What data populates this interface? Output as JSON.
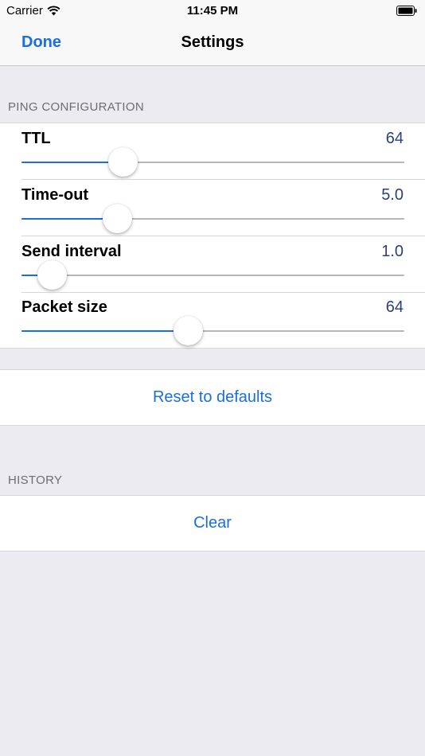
{
  "status_bar": {
    "carrier": "Carrier",
    "time": "11:45 PM",
    "wifi_icon": "wifi-icon",
    "battery_icon": "battery-icon"
  },
  "nav": {
    "done_label": "Done",
    "title": "Settings"
  },
  "ping_configuration": {
    "header": "PING CONFIGURATION",
    "sliders": [
      {
        "label": "TTL",
        "value": "64",
        "fraction": 0.265
      },
      {
        "label": "Time-out",
        "value": "5.0",
        "fraction": 0.25
      },
      {
        "label": "Send interval",
        "value": "1.0",
        "fraction": 0.08
      },
      {
        "label": "Packet size",
        "value": "64",
        "fraction": 0.435
      }
    ]
  },
  "reset": {
    "label": "Reset to defaults"
  },
  "history": {
    "header": "HISTORY",
    "clear_label": "Clear"
  },
  "colors": {
    "accent": "#1a6fe0",
    "value_text": "#2d3f7a",
    "background": "#ebebf1",
    "section_header": "#6d6d72"
  }
}
